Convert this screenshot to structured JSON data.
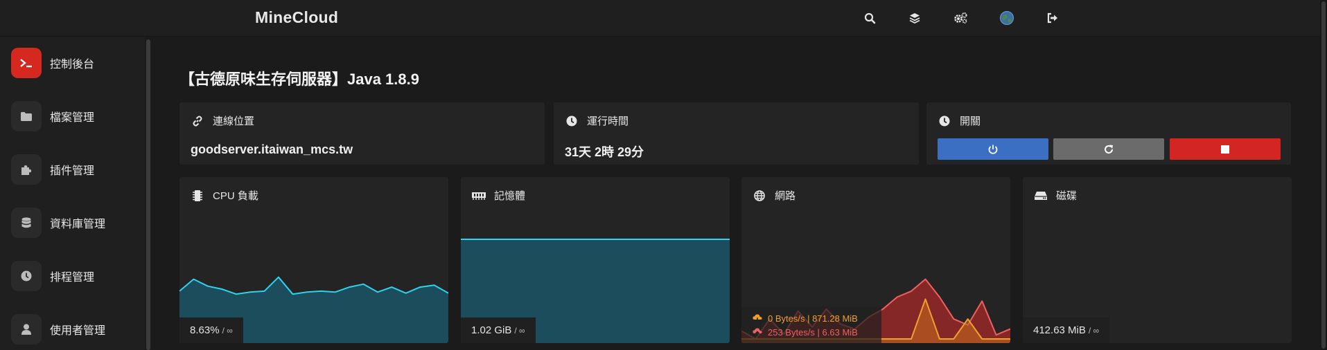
{
  "app": {
    "brand": "MineCloud"
  },
  "topbar": {
    "icons": [
      "search-icon",
      "layers-icon",
      "cogs-icon",
      "globe-avatar-icon",
      "sign-out-icon"
    ]
  },
  "sidebar": {
    "items": [
      {
        "label": "控制後台",
        "icon": "terminal-icon",
        "active": true
      },
      {
        "label": "檔案管理",
        "icon": "folder-icon"
      },
      {
        "label": "插件管理",
        "icon": "puzzle-icon"
      },
      {
        "label": "資料庫管理",
        "icon": "database-icon"
      },
      {
        "label": "排程管理",
        "icon": "clock-icon"
      },
      {
        "label": "使用者管理",
        "icon": "user-icon"
      }
    ]
  },
  "page": {
    "title": "【古德原味生存伺服器】Java 1.8.9"
  },
  "cards": {
    "address": {
      "label": "連線位置",
      "value": "goodserver.itaiwan_mcs.tw"
    },
    "uptime": {
      "label": "運行時間",
      "value": "31天 2時 29分"
    },
    "power": {
      "label": "開關",
      "buttons": [
        "power-button",
        "restart-button",
        "stop-button"
      ]
    }
  },
  "stats": {
    "cpu": {
      "label": "CPU 負載",
      "value": "8.63%",
      "limit": "/ ∞"
    },
    "memory": {
      "label": "記憶體",
      "value": "1.02 GiB",
      "limit": "/ ∞"
    },
    "network": {
      "label": "網路",
      "inbound": "0 Bytes/s | 871.28 MiB",
      "outbound": "253 Bytes/s | 6.63 MiB"
    },
    "disk": {
      "label": "磁碟",
      "value": "412.63 MiB",
      "limit": "/ ∞"
    }
  },
  "colors": {
    "accent_red": "#d5281e",
    "power_blue": "#3a6fc4",
    "restart_gray": "#6b6b6b",
    "stop_red": "#d42525",
    "chart_cyan": "#2fd3ef",
    "chart_fill": "#1b4d5c",
    "net_red": "#f06060",
    "net_orange": "#f0a030"
  },
  "chart_data": [
    {
      "type": "area",
      "series": [
        {
          "values": [
            48,
            60,
            53,
            50,
            45,
            47,
            48,
            62,
            45,
            47,
            48,
            47,
            52,
            55,
            47,
            52,
            46,
            52,
            54,
            46
          ]
        }
      ],
      "ylim": [
        0,
        100
      ]
    },
    {
      "type": "area",
      "series": [
        {
          "values": [
            100,
            100,
            100,
            100,
            100,
            100,
            100,
            100,
            100,
            100
          ]
        }
      ],
      "ylim": [
        0,
        100
      ]
    },
    {
      "type": "area",
      "series": [
        {
          "values": [
            8,
            0,
            20,
            5,
            28,
            12,
            30,
            15,
            10,
            22,
            30,
            42,
            48,
            60,
            42,
            20,
            14,
            38,
            4,
            10
          ]
        },
        {
          "values": [
            0,
            0,
            0,
            0,
            0,
            0,
            0,
            0,
            0,
            0,
            0,
            0,
            0,
            40,
            0,
            0,
            20,
            0,
            0,
            0
          ]
        }
      ],
      "ylim": [
        0,
        100
      ]
    }
  ]
}
